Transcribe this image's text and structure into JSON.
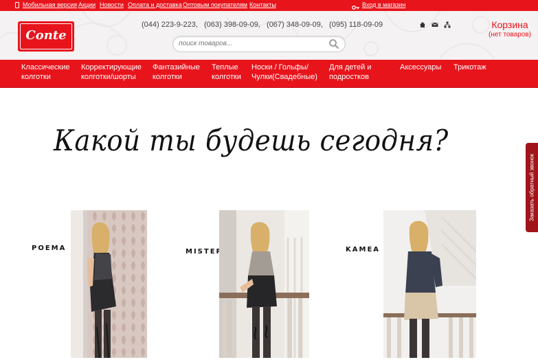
{
  "topbar": {
    "mobile": "Мобильная версия",
    "promo": "Акции",
    "news": "Новости",
    "payment": "Оплата и доставка",
    "wholesale": "Оптовым покупателям",
    "contacts": "Контакты",
    "login": "Вход в магазин"
  },
  "header": {
    "logo": "Conte",
    "phones": [
      "(044) 223-9-223,",
      "(063) 398-09-09,",
      "(067) 348-09-09,",
      "(095) 118-09-09"
    ],
    "search_placeholder": "поиск товаров...",
    "cart_title": "Корзина",
    "cart_status": "(нет товаров)"
  },
  "nav": [
    {
      "line1": "Классические",
      "line2": "колготки"
    },
    {
      "line1": "Корректирующие",
      "line2": "колготки/шорты"
    },
    {
      "line1": "Фантазийные",
      "line2": "колготки"
    },
    {
      "line1": "Теплые",
      "line2": "колготки"
    },
    {
      "line1": "Носки / Гольфы/",
      "line2": "Чулки(Свадебные)"
    },
    {
      "line1": "Для детей и",
      "line2": "подростков"
    },
    {
      "line1": "Аксессуары",
      "line2": ""
    },
    {
      "line1": "Трикотаж",
      "line2": ""
    }
  ],
  "main": {
    "headline": "Какой ты будешь сегодня?",
    "callback": "Заказать обратный звонок",
    "products": [
      {
        "label": "POEMA"
      },
      {
        "label": "MISTERY"
      },
      {
        "label": "KAMEA"
      }
    ]
  },
  "colors": {
    "brand": "#e8141c",
    "callback": "#a1141a"
  }
}
